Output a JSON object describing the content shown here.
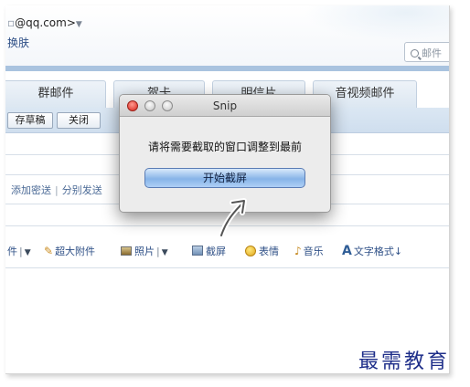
{
  "header": {
    "email": "@qq.com>",
    "skin_link": "换肤",
    "search_placeholder": "邮件"
  },
  "tabs": [
    {
      "label": "群邮件"
    },
    {
      "label": "贺卡"
    },
    {
      "label": "明信片"
    },
    {
      "label": "音视频邮件"
    }
  ],
  "toolbar": {
    "save_draft": "存草稿",
    "close": "关闭"
  },
  "recipients": {
    "add_bcc": "添加密送",
    "separator": "|",
    "send_separately": "分别发送"
  },
  "attachments": {
    "attach": "件",
    "big_attachment": "超大附件",
    "photo": "照片",
    "screenshot": "截屏",
    "emoji": "表情",
    "music": "音乐",
    "text_format": "文字格式↓"
  },
  "snip_dialog": {
    "title": "Snip",
    "message": "请将需要截取的窗口调整到最前",
    "start_button": "开始截屏"
  },
  "watermark": "最需教育"
}
